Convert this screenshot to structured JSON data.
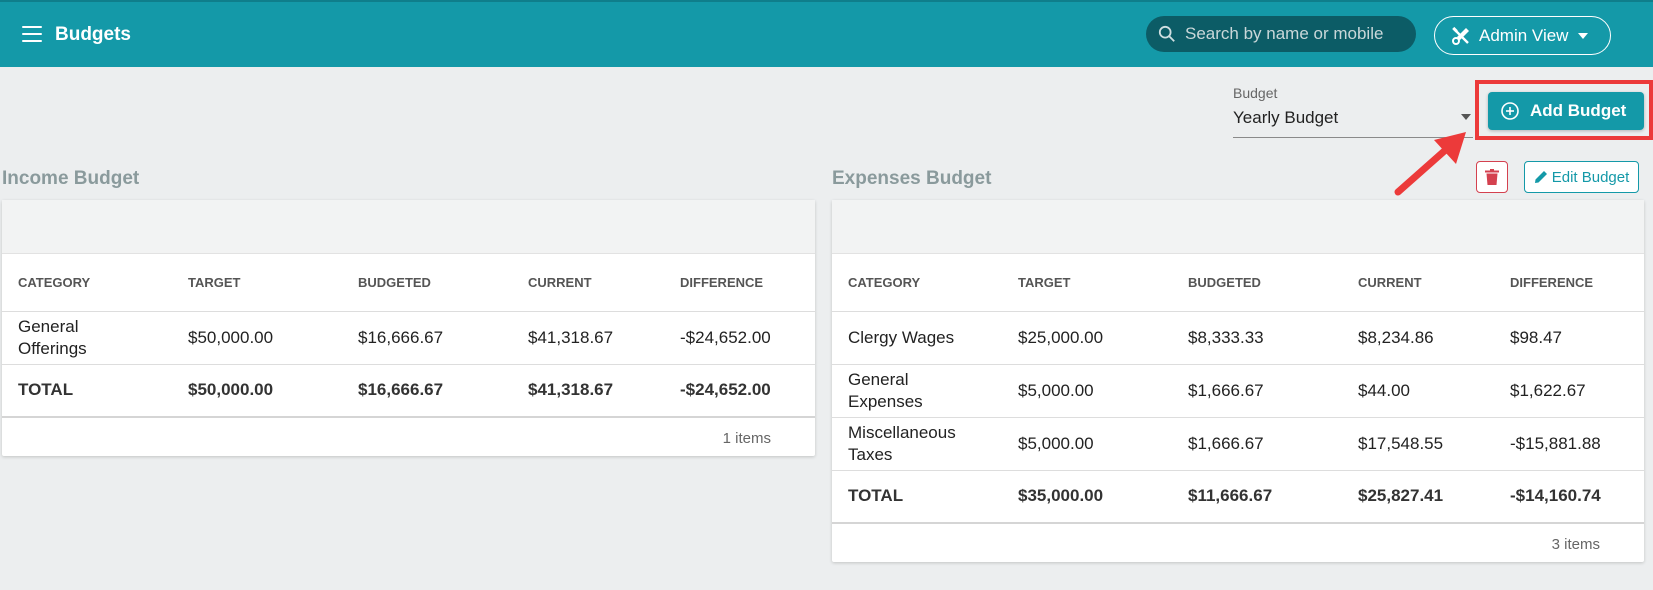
{
  "app": {
    "title": "Budgets"
  },
  "search": {
    "placeholder": "Search by name or mobile"
  },
  "admin_view": {
    "label": "Admin View"
  },
  "budget_select": {
    "label": "Budget",
    "value": "Yearly Budget"
  },
  "add_budget": {
    "label": "Add Budget"
  },
  "edit_budget": {
    "label": "Edit Budget"
  },
  "columns": [
    "CATEGORY",
    "TARGET",
    "BUDGETED",
    "CURRENT",
    "DIFFERENCE"
  ],
  "income": {
    "title": "Income Budget",
    "rows": [
      [
        "General Offerings",
        "$50,000.00",
        "$16,666.67",
        "$41,318.67",
        "-$24,652.00"
      ]
    ],
    "total": [
      "TOTAL",
      "$50,000.00",
      "$16,666.67",
      "$41,318.67",
      "-$24,652.00"
    ],
    "footer": "1 items"
  },
  "expenses": {
    "title": "Expenses Budget",
    "rows": [
      [
        "Clergy Wages",
        "$25,000.00",
        "$8,333.33",
        "$8,234.86",
        "$98.47"
      ],
      [
        "General Expenses",
        "$5,000.00",
        "$1,666.67",
        "$44.00",
        "$1,622.67"
      ],
      [
        "Miscellaneous Taxes",
        "$5,000.00",
        "$1,666.67",
        "$17,548.55",
        "-$15,881.88"
      ]
    ],
    "total": [
      "TOTAL",
      "$35,000.00",
      "$11,666.67",
      "$25,827.41",
      "-$14,160.74"
    ],
    "footer": "3 items"
  },
  "colors": {
    "accent": "#1499a8",
    "highlight": "#ec3a3a",
    "danger": "#d4414f"
  },
  "icons": [
    "menu-icon",
    "search-icon",
    "tools-icon",
    "plus-circle-icon",
    "trash-icon",
    "pencil-icon"
  ]
}
